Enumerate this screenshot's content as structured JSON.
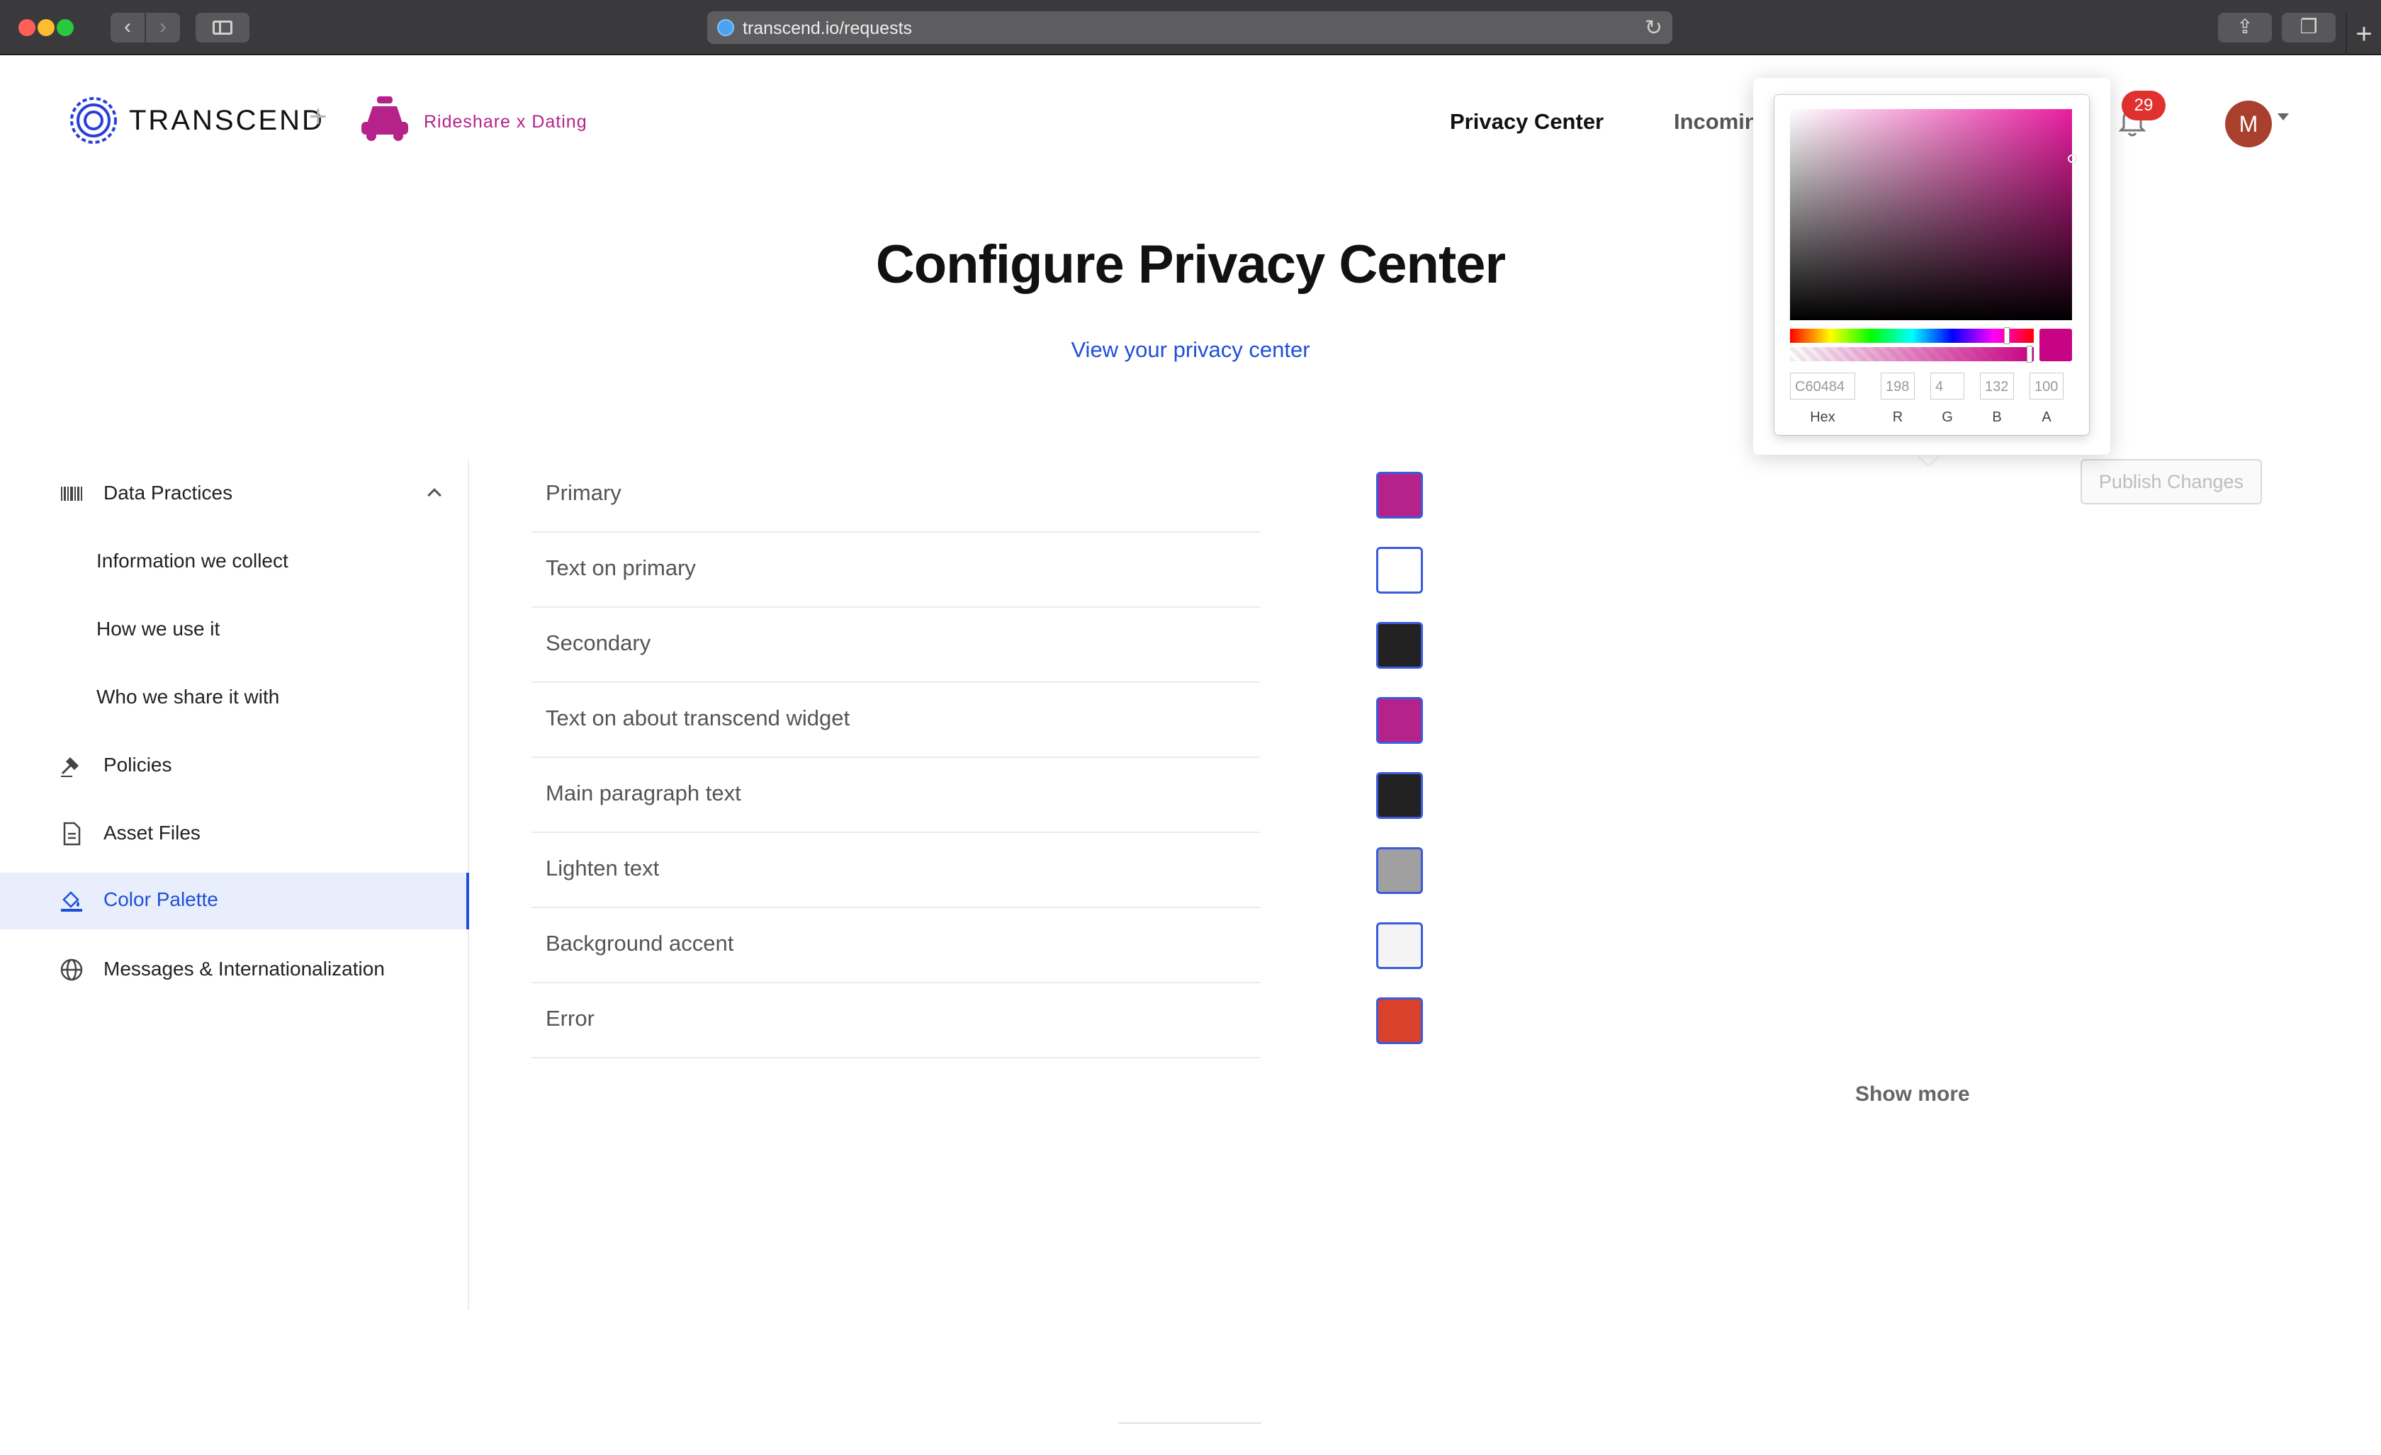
{
  "browser": {
    "url": "transcend.io/requests"
  },
  "header": {
    "brand": "TRANSCEND",
    "plus": "+",
    "org_name": "Rideshare x Dating",
    "nav": {
      "privacy_center": "Privacy Center",
      "incoming": "Incomin"
    },
    "notifications_count": "29",
    "avatar_initial": "M"
  },
  "main": {
    "title": "Configure Privacy Center",
    "view_link": "View your privacy center",
    "publish_label": "Publish Changes",
    "show_more": "Show more"
  },
  "sidebar": {
    "items": [
      {
        "label": "Data Practices",
        "icon": "barcode-icon"
      },
      {
        "label": "Information we collect"
      },
      {
        "label": "How we use it"
      },
      {
        "label": "Who we share it with"
      },
      {
        "label": "Policies",
        "icon": "gavel-icon"
      },
      {
        "label": "Asset Files",
        "icon": "file-icon"
      },
      {
        "label": "Color Palette",
        "icon": "paint-bucket-icon",
        "active": true
      },
      {
        "label": "Messages & Internationalization",
        "icon": "globe-icon"
      }
    ]
  },
  "colors": [
    {
      "label": "Primary",
      "color": "#b5238a"
    },
    {
      "label": "Text on primary",
      "color": "#ffffff"
    },
    {
      "label": "Secondary",
      "color": "#222222"
    },
    {
      "label": "Text on about transcend widget",
      "color": "#b5238a"
    },
    {
      "label": "Main paragraph text",
      "color": "#222222"
    },
    {
      "label": "Lighten text",
      "color": "#a0a0a0"
    },
    {
      "label": "Background accent",
      "color": "#f4f4f4"
    },
    {
      "label": "Error",
      "color": "#d9412b"
    }
  ],
  "picker": {
    "hex": "C60484",
    "r": "198",
    "g": "4",
    "b": "132",
    "a": "100",
    "labels": {
      "hex": "Hex",
      "r": "R",
      "g": "G",
      "b": "B",
      "a": "A"
    }
  }
}
